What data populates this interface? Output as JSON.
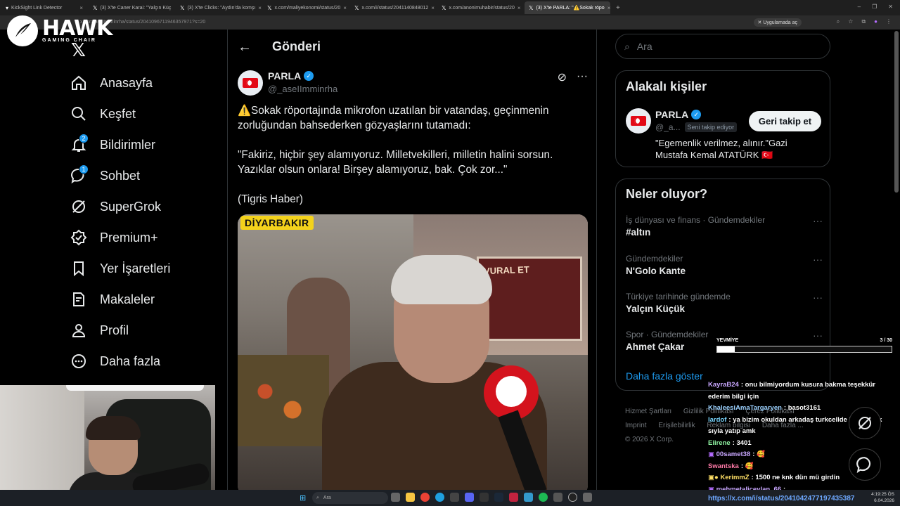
{
  "browser": {
    "tabs": [
      {
        "label": "KickSight Link Detector",
        "active": false
      },
      {
        "label": "(3) X'te Caner Karai: \"Yalçın Küç",
        "active": false
      },
      {
        "label": "(3) X'te Clicks: \"Aydın'da komşı",
        "active": false
      },
      {
        "label": "x.com/maliyekonomi/status/20",
        "active": false
      },
      {
        "label": "x.com/i/status/2041140848012",
        "active": false
      },
      {
        "label": "x.com/anonimuhabir/status/20",
        "active": false
      },
      {
        "label": "(3) X'te PARLA: \"⚠️Sokak röpo",
        "active": true
      }
    ],
    "url": "x.com/aseIImminrha/status/2041096711946357971?s=20",
    "app_badge": "Uygulamada aç"
  },
  "overlay_logo": {
    "title": "HAWK",
    "subtitle": "GAMING CHAIR"
  },
  "nav": {
    "items": [
      {
        "label": "Anasayfa",
        "icon": "home-icon",
        "badge": ""
      },
      {
        "label": "Keşfet",
        "icon": "search-icon",
        "badge": ""
      },
      {
        "label": "Bildirimler",
        "icon": "bell-icon",
        "badge": "2"
      },
      {
        "label": "Sohbet",
        "icon": "chat-icon",
        "badge": "1"
      },
      {
        "label": "SuperGrok",
        "icon": "grok-icon",
        "badge": ""
      },
      {
        "label": "Premium+",
        "icon": "verified-icon",
        "badge": ""
      },
      {
        "label": "Yer İşaretleri",
        "icon": "bookmark-icon",
        "badge": ""
      },
      {
        "label": "Makaleler",
        "icon": "article-icon",
        "badge": ""
      },
      {
        "label": "Profil",
        "icon": "profile-icon",
        "badge": ""
      },
      {
        "label": "Daha fazla",
        "icon": "more-circle-icon",
        "badge": ""
      }
    ]
  },
  "post_page": {
    "title": "Gönderi",
    "author": {
      "name": "PARLA",
      "handle": "@_aseIImminrha"
    },
    "text": [
      "⚠️Sokak röportajında mikrofon uzatılan bir vatandaş, geçinmenin zorluğundan bahsederken gözyaşlarını tutamadı:",
      "\"Fakiriz, hiçbir şey alamıyoruz. Milletvekilleri, milletin halini sorsun. Yazıklar olsun onlara! Birşey alamıyoruz, bak. Çok zor...\"",
      "(Tigris Haber)"
    ],
    "media": {
      "location_tag": "DİYARBAKIR",
      "shop_sign": "VURAL ET"
    }
  },
  "search": {
    "placeholder": "Ara"
  },
  "related": {
    "title": "Alakalı kişiler",
    "name": "PARLA",
    "handle": "@_a...",
    "follows_you": "Seni takip ediyor",
    "button": "Geri takip et",
    "bio": "\"Egemenlik verilmez, alınır.\"Gazi Mustafa Kemal ATATÜRK 🇹🇷"
  },
  "trends": {
    "title": "Neler oluyor?",
    "items": [
      {
        "category": "İş dünyası ve finans · Gündemdekiler",
        "name": "#altın"
      },
      {
        "category": "Gündemdekiler",
        "name": "N'Golo Kante"
      },
      {
        "category": "Türkiye tarihinde gündemde",
        "name": "Yalçın Küçük"
      },
      {
        "category": "Spor · Gündemdekiler",
        "name": "Ahmet Çakar"
      }
    ],
    "show_more": "Daha fazla göster"
  },
  "footer": {
    "links": [
      "Hizmet Şartları",
      "Gizlilik Politikası",
      "Çerez Politikası",
      "Imprint",
      "Erişilebilirlik",
      "Reklam bilgisi",
      "Daha fazla ..."
    ],
    "copyright": "© 2026 X Corp."
  },
  "stream_overlay": {
    "progress_label": "YEVMİYE",
    "progress_count": "3 / 30",
    "progress_fraction": 0.1,
    "chat": [
      {
        "user": "KayraB24",
        "color": "#c9a7ff",
        "message": ": onu bilmiyordum kusura bakma teşekkür ederim bilgi için"
      },
      {
        "user": "KhaleesiAmaTargaryen",
        "color": "#9bd1ff",
        "message": ": basot3161"
      },
      {
        "user": "lardof",
        "color": "#7ad7ff",
        "message": ": ya bizim okuldan arkadaş turkcellde işe girdi ik sıyla yatıp amk"
      },
      {
        "user": "Eiirene",
        "color": "#8ef0a0",
        "message": ": 3401"
      },
      {
        "user": "00samet38",
        "color": "#c9a7ff",
        "message": ": 🥰"
      },
      {
        "user": "Swantska",
        "color": "#ff7aa8",
        "message": ": 🥰"
      },
      {
        "user": "KerimmZ",
        "color": "#ffe066",
        "message": ": 1500 ne knk dün mü girdin"
      },
      {
        "user": "mehmetaliceylan_66",
        "color": "#c9a7ff",
        "message": ":"
      }
    ]
  },
  "status_url": "https://x.com/i/status/2041042477197435387",
  "taskbar": {
    "search_placeholder": "Ara",
    "time": "4:19:25 ÖS",
    "date": "6.04.2026"
  },
  "colors": {
    "accent": "#1d9bf0",
    "background": "#000000",
    "progress_border": "#cccccc"
  }
}
